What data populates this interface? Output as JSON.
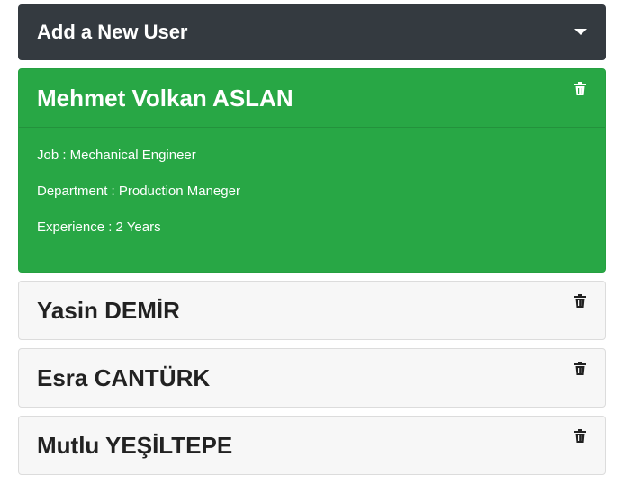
{
  "add_user": {
    "title": "Add a New User",
    "toggle_icon": "caret-down-icon"
  },
  "colors": {
    "header_bg": "#343a40",
    "active_card_bg": "#28a745",
    "card_bg": "#f7f7f7"
  },
  "users": [
    {
      "name": "Mehmet Volkan ASLAN",
      "expanded": true,
      "job": "Job : Mechanical Engineer",
      "department": "Department : Production Maneger",
      "experience": "Experience : 2 Years",
      "delete_icon": "trash-icon"
    },
    {
      "name": "Yasin DEMİR",
      "expanded": false,
      "delete_icon": "trash-icon"
    },
    {
      "name": "Esra CANTÜRK",
      "expanded": false,
      "delete_icon": "trash-icon"
    },
    {
      "name": "Mutlu YEŞİLTEPE",
      "expanded": false,
      "delete_icon": "trash-icon"
    }
  ]
}
